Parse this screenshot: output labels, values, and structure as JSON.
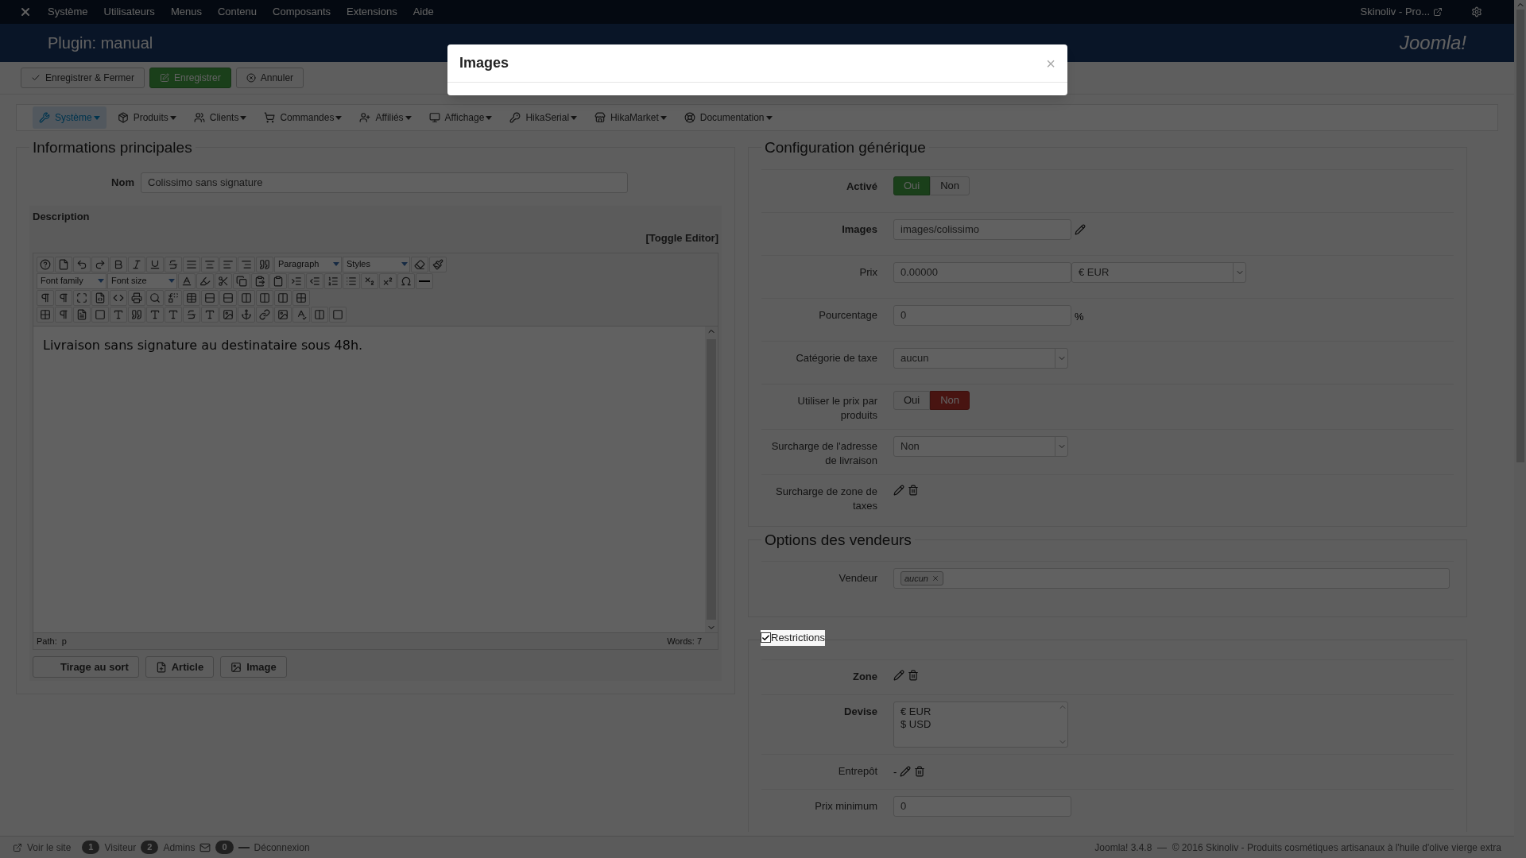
{
  "top_menu": {
    "items": [
      "Système",
      "Utilisateurs",
      "Menus",
      "Contenu",
      "Composants",
      "Extensions",
      "Aide"
    ],
    "site_link": "Skinoliv - Pro..."
  },
  "header": {
    "title": "Plugin: manual",
    "logo_text": "Joomla!"
  },
  "actions": [
    {
      "label": "Enregistrer & Fermer",
      "kind": "default"
    },
    {
      "label": "Enregistrer",
      "kind": "success"
    },
    {
      "label": "Annuler",
      "kind": "cancel"
    }
  ],
  "submenu": [
    {
      "label": "Système",
      "selected": true
    },
    {
      "label": "Produits",
      "selected": false
    },
    {
      "label": "Clients",
      "selected": false
    },
    {
      "label": "Commandes",
      "selected": false
    },
    {
      "label": "Affiliés",
      "selected": false
    },
    {
      "label": "Affichage",
      "selected": false
    },
    {
      "label": "HikaSerial",
      "selected": false
    },
    {
      "label": "HikaMarket",
      "selected": false
    },
    {
      "label": "Documentation",
      "selected": false
    }
  ],
  "main_info": {
    "title": "Informations principales",
    "name_label": "Nom",
    "name_value": "Colissimo sans signature",
    "description_label": "Description",
    "toggle": "[Toggle Editor]",
    "editor": {
      "block_format": "Paragraph",
      "styles": "Styles",
      "font_family": "Font family",
      "font_size": "Font size",
      "content": "Livraison sans signature au destinataire sous 48h.",
      "path": "Path:  p",
      "words": "Words: 7"
    },
    "buttons": [
      "Tirage au sort",
      "Article",
      "Image"
    ]
  },
  "generic": {
    "title": "Configuration générique",
    "rows": [
      {
        "kind": "toggle",
        "label": "Activé",
        "bold": true,
        "options": [
          {
            "label": "Oui",
            "selected": true
          },
          {
            "label": "Non",
            "selected": false
          }
        ]
      },
      {
        "kind": "text",
        "label": "Images",
        "bold": true,
        "value": "images/colissimo",
        "edit": true
      },
      {
        "kind": "price",
        "label": "Prix",
        "bold": false,
        "value": "0.00000",
        "currency": "€ EUR"
      },
      {
        "kind": "text",
        "label": "Pourcentage",
        "bold": false,
        "value": "0",
        "suffix": "%"
      },
      {
        "kind": "select",
        "label": "Catégorie de taxe",
        "bold": false,
        "value": "aucun"
      },
      {
        "kind": "toggle",
        "label": "Utiliser le prix par produits",
        "bold": false,
        "options": [
          {
            "label": "Oui",
            "selected": false
          },
          {
            "label": "Non",
            "selected": true
          }
        ]
      },
      {
        "kind": "select",
        "label": "Surcharge de l'adresse de livraison",
        "bold": false,
        "value": "Non"
      },
      {
        "kind": "icons",
        "label": "Surcharge de zone de taxes",
        "bold": false
      }
    ]
  },
  "vendors": {
    "title": "Options des vendeurs",
    "rows": [
      {
        "kind": "tags",
        "label": "Vendeur",
        "bold": false,
        "tags": [
          "aucun"
        ]
      }
    ]
  },
  "restrictions": {
    "title": "Restrictions",
    "checked": true,
    "rows": [
      {
        "kind": "icons",
        "label": "Zone",
        "bold": true
      },
      {
        "kind": "list",
        "label": "Devise",
        "bold": true,
        "options": [
          "€ EUR",
          "$ USD"
        ]
      },
      {
        "kind": "icons",
        "label": "Entrepôt",
        "bold": false,
        "prefix": "-"
      },
      {
        "kind": "text",
        "label": "Prix minimum",
        "bold": false,
        "value": "0"
      }
    ]
  },
  "status_bar": {
    "view_site": "Voir le site",
    "visitors_count": "1",
    "visitors": "Visiteur",
    "admins_count": "2",
    "admins": "Admins",
    "messages_count": "0",
    "logout": "Déconnexion",
    "footer": "Joomla! 3.4.8  —  © 2016 Skinoliv - Produits cosmétiques artisanaux à l'huile d'olive vierge extra"
  },
  "modal": {
    "title": "Images",
    "close": "×"
  }
}
